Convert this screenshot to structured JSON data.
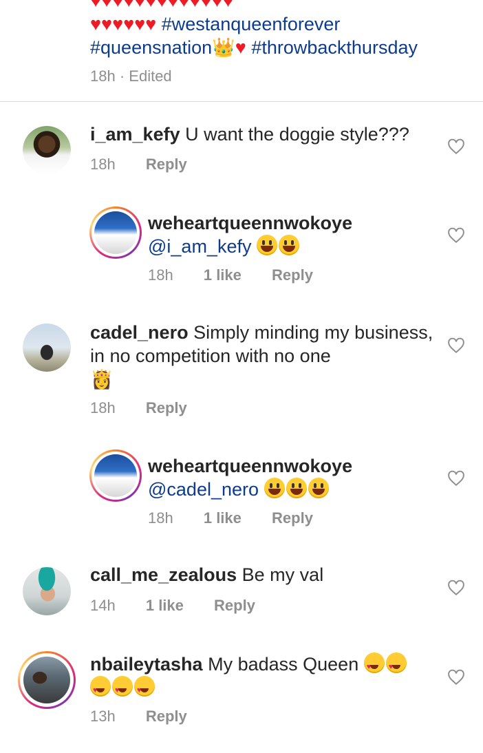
{
  "caption": {
    "line1_hearts": "♥♥♥♥♥♥",
    "line1_tag": "#westanqueenforever",
    "line2_tag1": "#queensnation",
    "line2_crown": "👑",
    "line2_heart": "♥",
    "line2_tag2": "#throwbackthursday",
    "time": "18h",
    "edited": "· Edited"
  },
  "comments": [
    {
      "user": "i_am_kefy",
      "text": "U want the doggie style???",
      "time": "18h",
      "likes": "",
      "reply": "Reply"
    },
    {
      "user": "weheartqueennwokoye",
      "mention": "@i_am_kefy",
      "time": "18h",
      "likes": "1 like",
      "reply": "Reply"
    },
    {
      "user": "cadel_nero",
      "text": "Simply minding my business, in no competition with no one",
      "time": "18h",
      "likes": "",
      "reply": "Reply",
      "emoji": "👸"
    },
    {
      "user": "weheartqueennwokoye",
      "mention": "@cadel_nero",
      "time": "18h",
      "likes": "1 like",
      "reply": "Reply"
    },
    {
      "user": "call_me_zealous",
      "text": "Be my val",
      "time": "14h",
      "likes": "1 like",
      "reply": "Reply"
    },
    {
      "user": "nbaileytasha",
      "text": "My badass Queen",
      "time": "13h",
      "likes": "",
      "reply": "Reply"
    }
  ],
  "icons": {
    "like": "heart-outline-icon"
  }
}
